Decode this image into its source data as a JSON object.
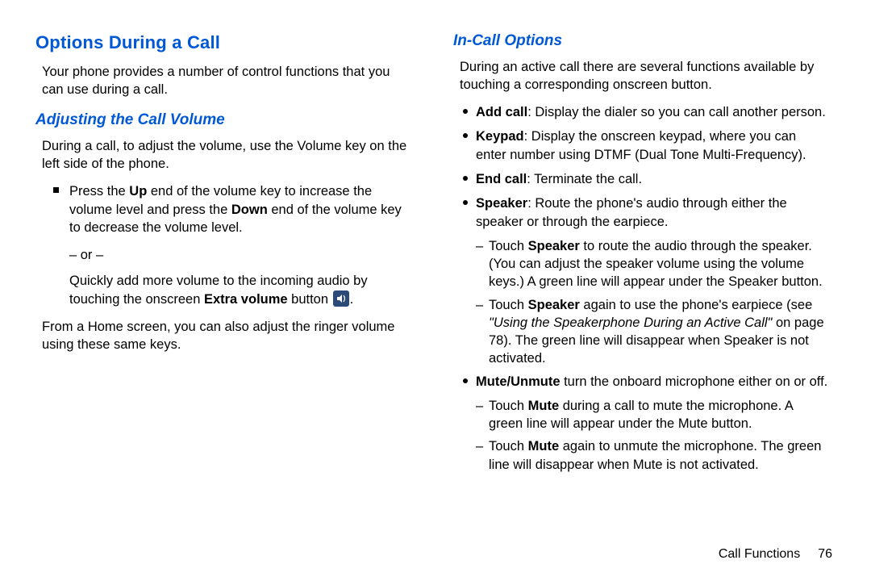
{
  "left": {
    "h1": "Options During a Call",
    "intro": "Your phone provides a number of control functions that you can use during a call.",
    "h2": "Adjusting the Call Volume",
    "p1": "During a call, to adjust the volume, use the Volume key on the left side of the phone.",
    "vol_a": "Press the ",
    "vol_up": "Up",
    "vol_b": " end of the volume key to increase the volume level and press the ",
    "vol_down": "Down",
    "vol_c": " end of the volume key to decrease the volume level.",
    "or": "– or –",
    "ev_a": "Quickly add more volume to the incoming audio by touching the onscreen ",
    "ev_b": "Extra volume",
    "ev_c": " button ",
    "ev_d": ".",
    "p_home": "From a Home screen, you can also adjust the ringer volume using these same keys."
  },
  "right": {
    "h2": "In-Call Options",
    "intro": "During an active call there are several functions available by touching a corresponding onscreen button.",
    "add_b": "Add call",
    "add_t": ": Display the dialer so you can call another person.",
    "kp_b": "Keypad",
    "kp_t": ": Display the onscreen keypad, where you can enter number using DTMF (Dual Tone Multi-Frequency).",
    "end_b": "End call",
    "end_t": ": Terminate the call.",
    "spk_b": "Speaker",
    "spk_t": ": Route the phone's audio through either the speaker or through the earpiece.",
    "spk1_a": "Touch ",
    "spk1_b": "Speaker",
    "spk1_c": " to route the audio through the speaker. (You can adjust the speaker volume using the volume keys.) A green line will appear under the Speaker button.",
    "spk2_a": "Touch ",
    "spk2_b": "Speaker",
    "spk2_c": " again to use the phone's earpiece (see ",
    "spk2_ref": "\"Using the Speakerphone During an Active Call\"",
    "spk2_d": " on page 78). The green line will disappear when Speaker is not activated.",
    "mute_b": "Mute/Unmute",
    "mute_t": " turn the onboard microphone either on or off.",
    "mute1_a": "Touch ",
    "mute1_b": "Mute",
    "mute1_c": " during a call to mute the microphone. A green line will appear under the Mute button.",
    "mute2_a": "Touch ",
    "mute2_b": "Mute",
    "mute2_c": " again to unmute the microphone. The green line will disappear when Mute is not activated."
  },
  "footer": {
    "section": "Call Functions",
    "page": "76"
  }
}
